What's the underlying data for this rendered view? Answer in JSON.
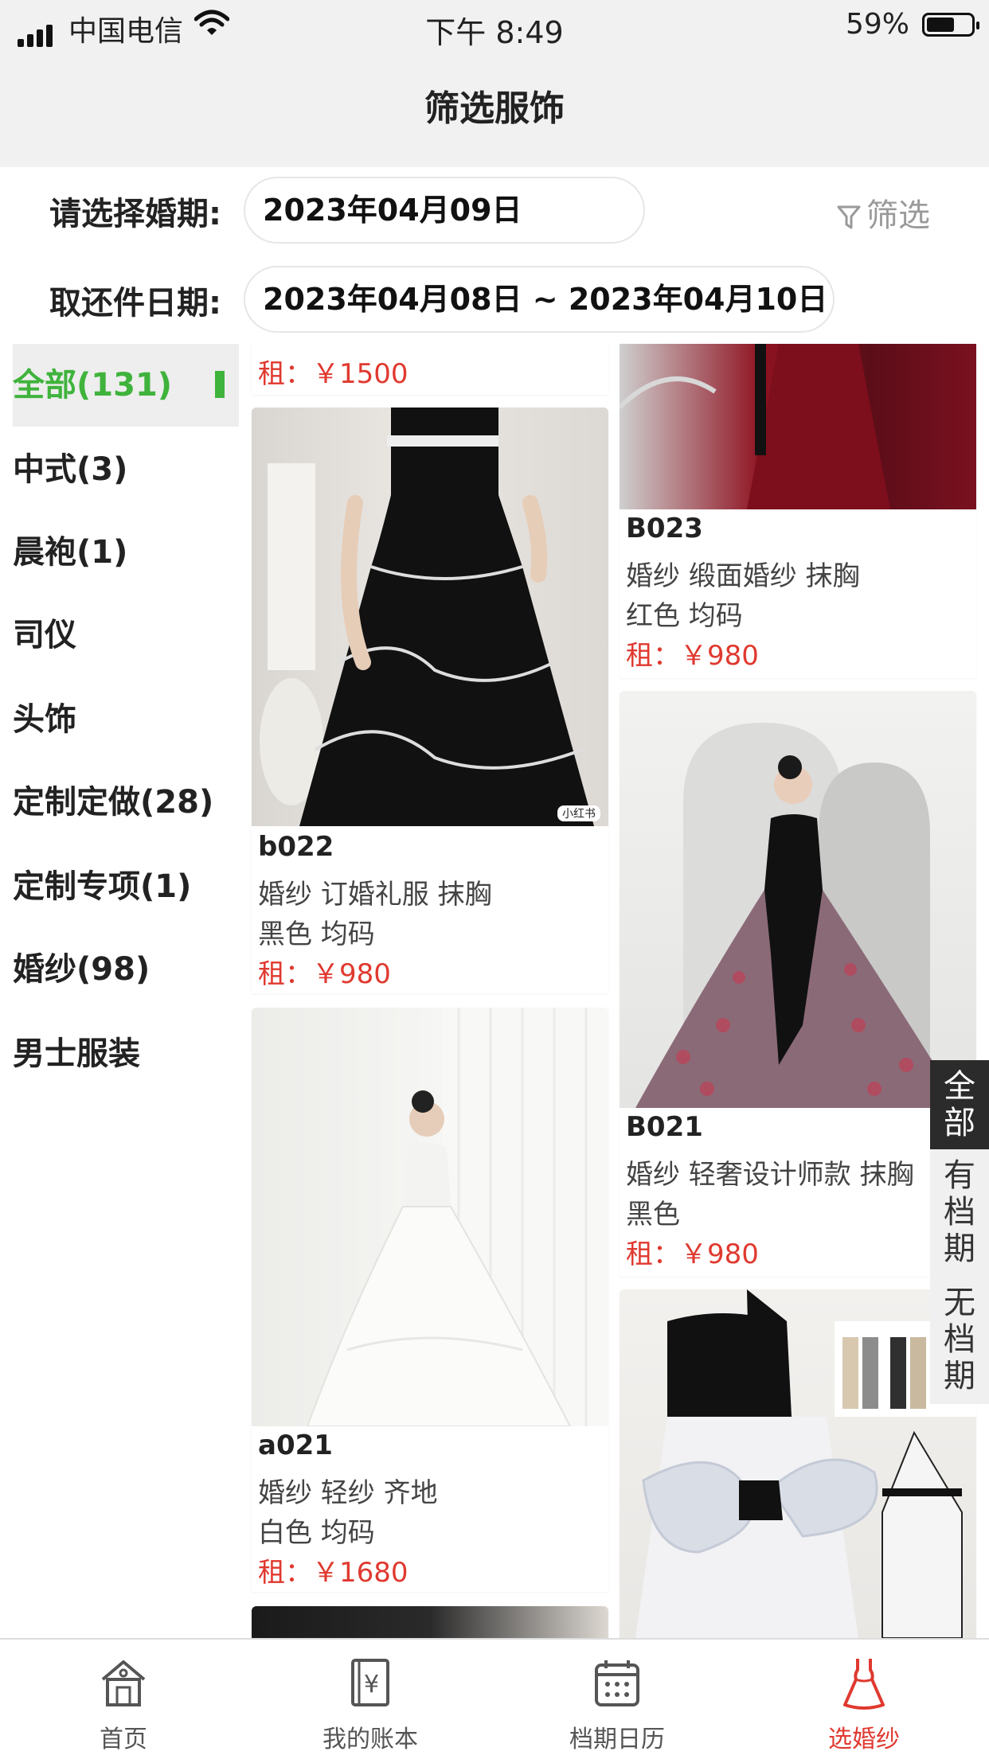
{
  "status_bar": {
    "carrier": "中国电信",
    "time": "下午 8:49",
    "battery": "59%"
  },
  "page_title": "筛选服饰",
  "filters": {
    "wedding_label": "请选择婚期:",
    "wedding_date": "2023年04月09日",
    "pickup_label": "取还件日期:",
    "pickup_range": "2023年04月08日 ~ 2023年04月10日",
    "filter_button": "筛选"
  },
  "categories": [
    {
      "label": "全部(131)",
      "active": true
    },
    {
      "label": "中式(3)"
    },
    {
      "label": "晨袍(1)"
    },
    {
      "label": "司仪"
    },
    {
      "label": "头饰"
    },
    {
      "label": "定制定做(28)"
    },
    {
      "label": "定制专项(1)"
    },
    {
      "label": "婚纱(98)"
    },
    {
      "label": "男士服装"
    }
  ],
  "products": {
    "partial_price": "租：￥1500",
    "b022": {
      "code": "b022",
      "tags": "婚纱 订婚礼服 抹胸",
      "color": "黑色 均码",
      "price": "租：￥980",
      "watermark": "小红书"
    },
    "a021": {
      "code": "a021",
      "tags": "婚纱 轻纱 齐地",
      "color": "白色 均码",
      "price": "租：￥1680"
    },
    "B023": {
      "code": "B023",
      "tags": "婚纱 缎面婚纱 抹胸",
      "color": "红色 均码",
      "price": "租：￥980"
    },
    "B021": {
      "code": "B021",
      "tags": "婚纱 轻奢设计师款 抹胸",
      "color": "黑色",
      "price": "租：￥980"
    }
  },
  "side_tabs": [
    "全部",
    "有档期",
    "无档期"
  ],
  "tabbar": [
    {
      "label": "首页",
      "icon": "home-icon"
    },
    {
      "label": "我的账本",
      "icon": "ledger-icon"
    },
    {
      "label": "档期日历",
      "icon": "calendar-icon"
    },
    {
      "label": "选婚纱",
      "icon": "dress-icon",
      "active": true
    }
  ],
  "colors": {
    "accent_green": "#3fb33c",
    "price_red": "#e0392f",
    "active_tab_red": "#e0392f"
  }
}
